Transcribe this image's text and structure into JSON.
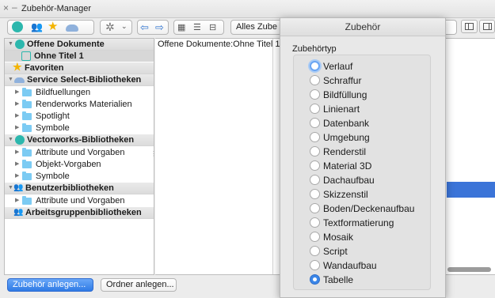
{
  "window": {
    "title": "Zubehör-Manager"
  },
  "toolbar": {
    "filter_label": "Alles Zube"
  },
  "sidebar": {
    "rows": [
      {
        "label": "Offene Dokumente"
      },
      {
        "label": "Ohne Titel 1"
      },
      {
        "label": "Favoriten"
      },
      {
        "label": "Service Select-Bibliotheken"
      },
      {
        "label": "Bildfuellungen"
      },
      {
        "label": "Renderworks Materialien"
      },
      {
        "label": "Spotlight"
      },
      {
        "label": "Symbole"
      },
      {
        "label": "Vectorworks-Bibliotheken"
      },
      {
        "label": "Attribute und Vorgaben"
      },
      {
        "label": "Objekt-Vorgaben"
      },
      {
        "label": "Symbole"
      },
      {
        "label": "Benutzerbibliotheken"
      },
      {
        "label": "Attribute und Vorgaben"
      },
      {
        "label": "Arbeitsgruppenbibliotheken"
      }
    ]
  },
  "main": {
    "path": "Offene Dokumente:Ohne Titel 1"
  },
  "buttons": {
    "create": "Zubehör anlegen...",
    "new_folder": "Ordner anlegen..."
  },
  "popover": {
    "title": "Zubehör",
    "group_label": "Zubehörtyp",
    "options": [
      "Verlauf",
      "Schraffur",
      "Bildfüllung",
      "Linienart",
      "Datenbank",
      "Umgebung",
      "Renderstil",
      "Material 3D",
      "Dachaufbau",
      "Skizzenstil",
      "Boden/Deckenaufbau",
      "Textformatierung",
      "Mosaik",
      "Script",
      "Wandaufbau",
      "Tabelle"
    ],
    "selected": "Tabelle",
    "focused": "Verlauf"
  },
  "colors": {
    "accent": "#3b86e8",
    "folder": "#7ccbf3",
    "selection": "#3b74d8"
  }
}
